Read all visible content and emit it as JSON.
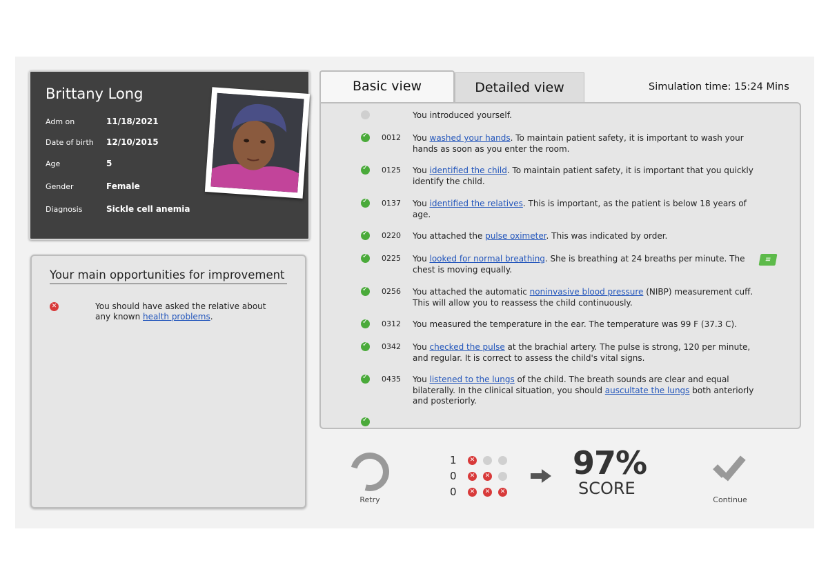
{
  "patient": {
    "name": "Brittany Long",
    "fields": [
      {
        "label": "Adm on",
        "value": "11/18/2021"
      },
      {
        "label": "Date of birth",
        "value": "12/10/2015"
      },
      {
        "label": "Age",
        "value": "5"
      },
      {
        "label": "Gender",
        "value": "Female"
      },
      {
        "label": "Diagnosis",
        "value": "Sickle cell anemia"
      }
    ]
  },
  "improvement": {
    "title": "Your main opportunities for improvement",
    "item_pre": "You should have asked the relative about any known ",
    "item_link": "health problems",
    "item_post": "."
  },
  "tabs": {
    "basic": "Basic view",
    "detailed": "Detailed view"
  },
  "simulation_time": "Simulation time: 15:24 Mins",
  "log": [
    {
      "status": "none",
      "time": "",
      "pre": "You introduced yourself.",
      "link": "",
      "post": ""
    },
    {
      "status": "ok",
      "time": "0012",
      "pre": "You ",
      "link": "washed your hands",
      "post": ". To maintain patient safety, it is important to wash your hands as soon as you enter the room."
    },
    {
      "status": "ok",
      "time": "0125",
      "pre": "You ",
      "link": "identified the child",
      "post": ". To maintain patient safety, it is important that you quickly identify the child."
    },
    {
      "status": "ok",
      "time": "0137",
      "pre": "You ",
      "link": "identified the relatives",
      "post": ". This is important, as the patient is below 18 years of age."
    },
    {
      "status": "ok",
      "time": "0220",
      "pre": "You attached the ",
      "link": "pulse oximeter",
      "post": ". This was indicated by order."
    },
    {
      "status": "ok",
      "time": "0225",
      "pre": "You ",
      "link": "looked for normal breathing",
      "post": ". She is breathing at 24 breaths per minute. The chest is moving equally."
    },
    {
      "status": "ok",
      "time": "0256",
      "pre": "You attached the automatic ",
      "link": "noninvasive blood pressure",
      "post": " (NIBP) measurement cuff. This will allow you to reassess the child continuously."
    },
    {
      "status": "ok",
      "time": "0312",
      "pre": "You measured the temperature in the ear. The temperature was 99 F (37.3 C).",
      "link": "",
      "post": ""
    },
    {
      "status": "ok",
      "time": "0342",
      "pre": "You ",
      "link": "checked the pulse",
      "post": " at the brachial artery. The pulse is strong, 120 per minute, and regular. It is correct to assess the child's vital signs."
    },
    {
      "status": "ok",
      "time": "0435",
      "pre": "You ",
      "link": "listened to the lungs",
      "post": " of the child. The breath sounds are clear and equal bilaterally. In the clinical situation, you should ",
      "link2": "auscultate the lungs",
      "post2": " both anteriorly and posteriorly."
    }
  ],
  "counts": [
    "1",
    "0",
    "0"
  ],
  "score": {
    "percent": "97%",
    "label": "SCORE"
  },
  "actions": {
    "retry": "Retry",
    "continue": "Continue"
  }
}
